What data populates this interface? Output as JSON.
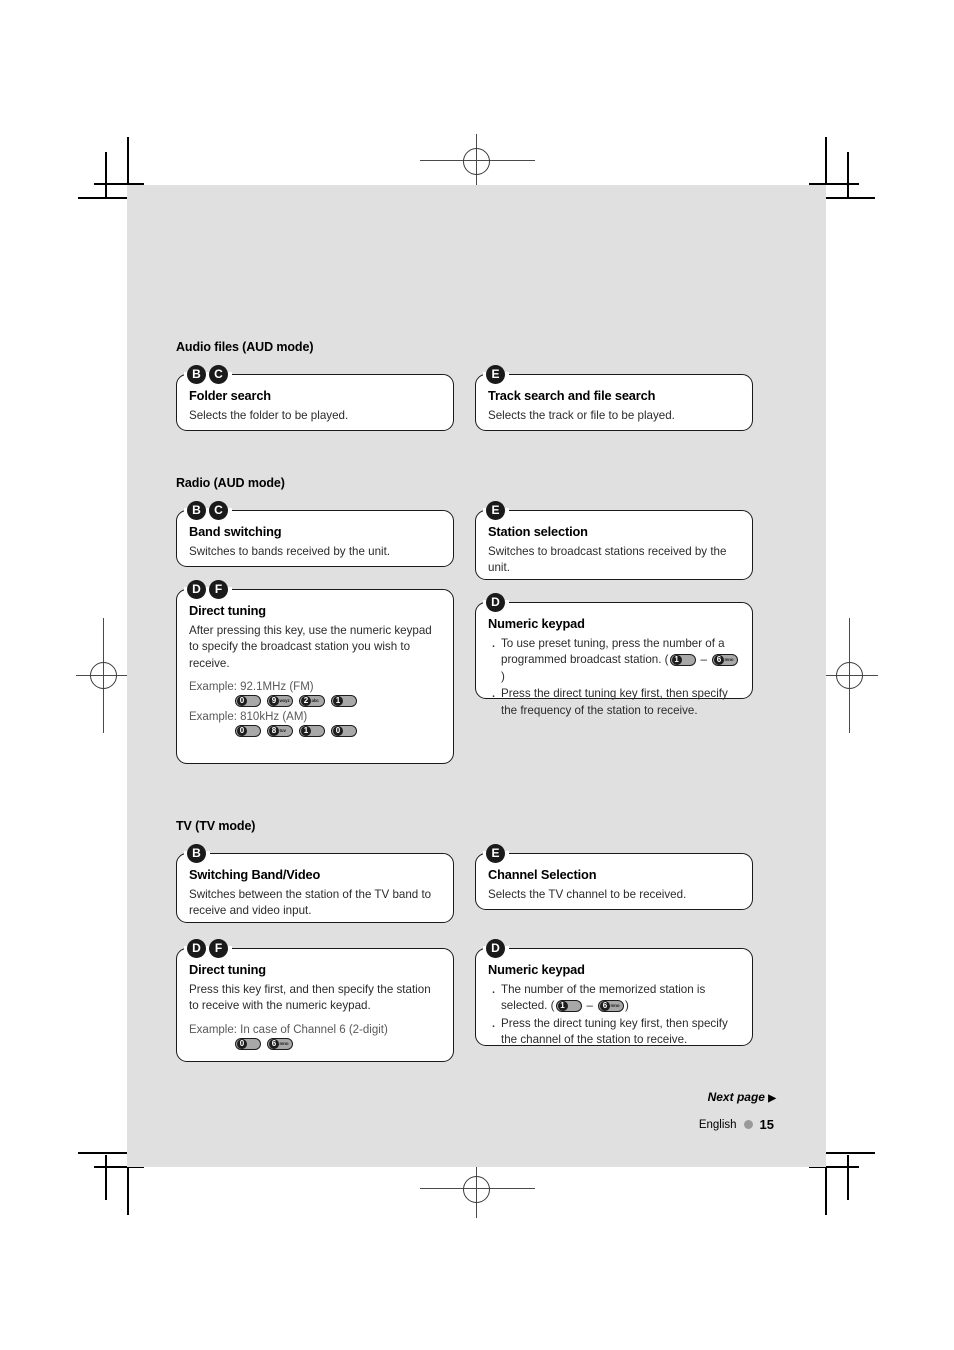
{
  "page": {
    "language": "English",
    "number": "15",
    "next_page_label": "Next page",
    "next_page_arrow": "▶"
  },
  "sections": [
    {
      "id": "audio-files",
      "title": "Audio files (AUD mode)",
      "left": {
        "badges": [
          "B",
          "C"
        ],
        "title": "Folder search",
        "text": "Selects the folder to be played."
      },
      "right": {
        "badges": [
          "E"
        ],
        "title": "Track search and file search",
        "text": "Selects the track or file to be played."
      }
    },
    {
      "id": "radio",
      "title": "Radio (AUD mode)",
      "left_top": {
        "badges": [
          "B",
          "C"
        ],
        "title": "Band switching",
        "text": "Switches to bands received by the unit."
      },
      "right_top": {
        "badges": [
          "E"
        ],
        "title": "Station selection",
        "text": "Switches to broadcast stations received by the unit."
      },
      "left_bottom": {
        "badges": [
          "D",
          "F"
        ],
        "title": "Direct tuning",
        "text": "After pressing this key, use the numeric keypad to specify the broadcast station you wish to receive.",
        "example1_label": "Example: 92.1MHz (FM)",
        "example1_keys": [
          {
            "digit": "0",
            "sub": ""
          },
          {
            "digit": "9",
            "sub": "wxyz"
          },
          {
            "digit": "2",
            "sub": "abc"
          },
          {
            "digit": "1",
            "sub": ""
          }
        ],
        "example2_label": "Example: 810kHz (AM)",
        "example2_keys": [
          {
            "digit": "0",
            "sub": ""
          },
          {
            "digit": "8",
            "sub": "tuv"
          },
          {
            "digit": "1",
            "sub": ""
          },
          {
            "digit": "0",
            "sub": ""
          }
        ]
      },
      "right_bottom": {
        "badges": [
          "D"
        ],
        "title": "Numeric keypad",
        "bullet1_pre": "To use preset tuning, press the number of a programmed broadcast station. (",
        "bullet1_key_from": {
          "digit": "1",
          "sub": ""
        },
        "bullet1_sep": "–",
        "bullet1_key_to": {
          "digit": "6",
          "sub": "mno"
        },
        "bullet1_post": ")",
        "bullet2": "Press the direct tuning key first, then specify the frequency of the station to receive."
      }
    },
    {
      "id": "tv",
      "title": "TV (TV mode)",
      "left_top": {
        "badges": [
          "B"
        ],
        "title": "Switching Band/Video",
        "text": "Switches between the station of the TV band to receive and video input."
      },
      "right_top": {
        "badges": [
          "E"
        ],
        "title": "Channel Selection",
        "text": "Selects the TV channel to be received."
      },
      "left_bottom": {
        "badges": [
          "D",
          "F"
        ],
        "title": "Direct tuning",
        "text": "Press this key first, and then specify the station to receive with the numeric keypad.",
        "example1_label": "Example: In case of Channel 6 (2-digit)",
        "example1_keys": [
          {
            "digit": "0",
            "sub": ""
          },
          {
            "digit": "6",
            "sub": "mno"
          }
        ]
      },
      "right_bottom": {
        "badges": [
          "D"
        ],
        "title": "Numeric keypad",
        "bullet1_pre": "The number of the memorized station is selected. (",
        "bullet1_key_from": {
          "digit": "1",
          "sub": ""
        },
        "bullet1_sep": "–",
        "bullet1_key_to": {
          "digit": "6",
          "sub": "mno"
        },
        "bullet1_post": ")",
        "bullet2": "Press the direct tuning key first, then specify the channel of the station to receive."
      }
    }
  ],
  "colors": {
    "page_background": "#e0e0e0",
    "box_background": "#ffffff",
    "box_border": "#1a1a1a",
    "badge_background": "#1a1a1a",
    "key_fill": "#a8a8a8"
  }
}
